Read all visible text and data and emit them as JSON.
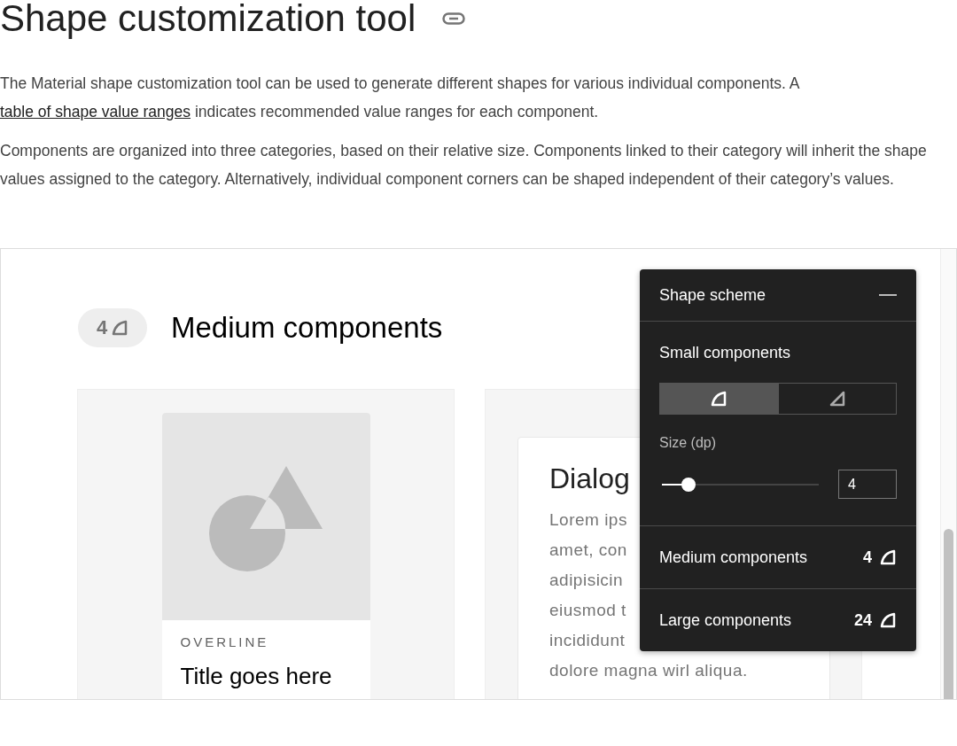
{
  "heading": "Shape customization tool",
  "paragraphs": [
    {
      "text": "The Material shape customization tool can be used to generate different shapes for various individual components. A ",
      "link": "table of shape value ranges",
      "after": " indicates recommended value ranges for each component."
    },
    {
      "text": "Components are organized into three categories, based on their relative size. Components linked to their category will inherit the shape values assigned to the category. Alternatively, individual component corners can be shaped independent of their category’s values."
    }
  ],
  "demo": {
    "chip": "4",
    "title": "Medium components",
    "card": {
      "kind": "picture",
      "overline": "OVERLINE",
      "title": "Title goes here"
    },
    "dialog": {
      "title": "Dialog",
      "lines": [
        "Lorem ips",
        "amet, con",
        "adipisicin",
        "eiusmod t",
        "incididunt",
        "dolore magna wirl aliqua."
      ]
    }
  },
  "panel": {
    "title": "Shape scheme",
    "section": "Small components",
    "shape_options": [
      {
        "kind": "rounded",
        "selected": true
      },
      {
        "kind": "cut",
        "selected": false
      }
    ],
    "size_label": "Size (dp)",
    "size": {
      "level": 0.17,
      "value": "4"
    },
    "rows": [
      {
        "label": "Medium components",
        "value": "4"
      },
      {
        "label": "Large components",
        "value": "24"
      }
    ]
  }
}
